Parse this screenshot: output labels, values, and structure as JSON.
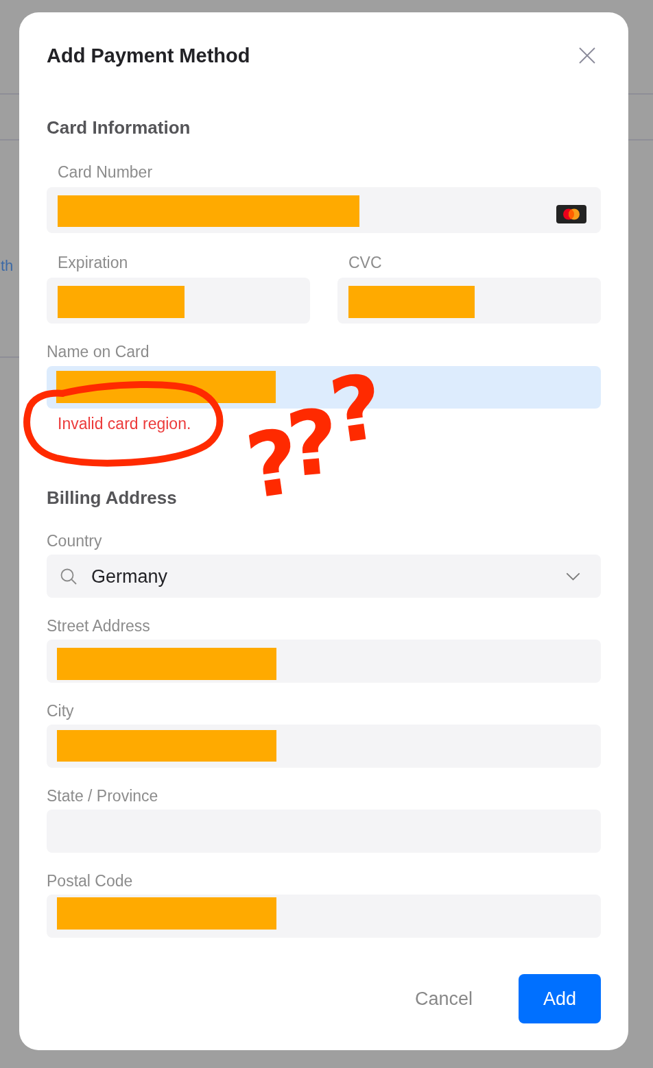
{
  "background_page": {
    "link_fragment": "th"
  },
  "dialog": {
    "title": "Add Payment Method"
  },
  "card_information": {
    "heading": "Card Information",
    "card_number": {
      "label": "Card Number",
      "redacted": true
    },
    "expiration": {
      "label": "Expiration",
      "redacted": true
    },
    "cvc": {
      "label": "CVC",
      "redacted": true
    },
    "name_on_card": {
      "label": "Name on Card",
      "redacted": true,
      "focused": true,
      "error": "Invalid card region."
    }
  },
  "billing_address": {
    "heading": "Billing Address",
    "country": {
      "label": "Country",
      "value": "Germany"
    },
    "street_address": {
      "label": "Street Address",
      "redacted": true
    },
    "city": {
      "label": "City",
      "redacted": true
    },
    "state_province": {
      "label": "State / Province",
      "redacted": false
    },
    "postal_code": {
      "label": "Postal Code",
      "redacted": true
    }
  },
  "buttons": [
    {
      "label": "Cancel",
      "kind": "secondary"
    },
    {
      "label": "Add",
      "kind": "primary"
    }
  ],
  "annotations": [
    {
      "kind": "ellipse"
    },
    {
      "kind": "question_mark",
      "text": "?"
    },
    {
      "kind": "question_mark",
      "text": "?"
    },
    {
      "kind": "question_mark",
      "text": "?"
    }
  ]
}
